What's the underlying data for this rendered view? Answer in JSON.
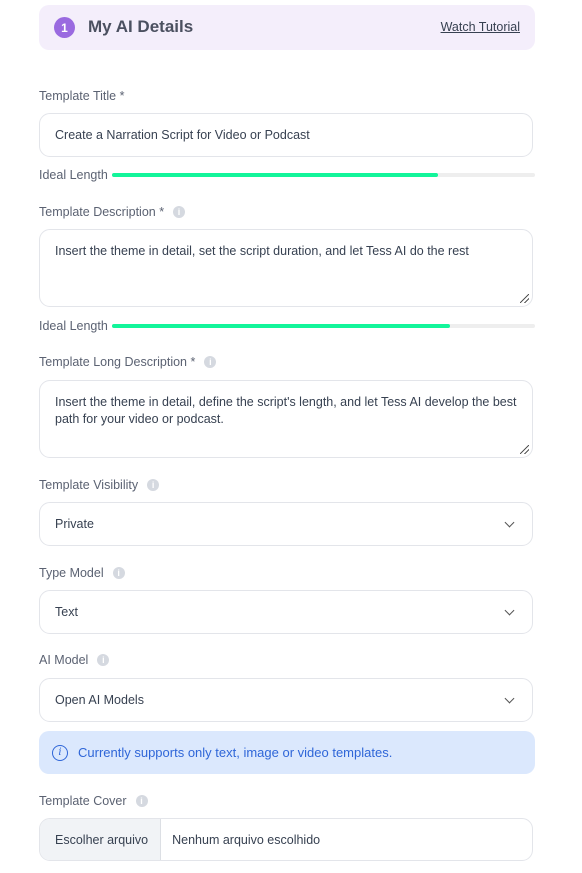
{
  "header": {
    "step_number": "1",
    "title": "My AI Details",
    "tutorial_link": "Watch Tutorial"
  },
  "colors": {
    "accent_purple": "#9a6ae0",
    "header_bg": "#f4eefb",
    "progress_fill": "#12f59a",
    "alert_bg": "#dbe8fd",
    "alert_text": "#2f66d8"
  },
  "fields": {
    "title": {
      "label": "Template Title *",
      "value": "Create a Narration Script for Video or Podcast",
      "ideal_length_label": "Ideal Length",
      "ideal_length_progress": 0.77
    },
    "description": {
      "label": "Template Description *",
      "value": "Insert the theme in detail, set the script duration, and let Tess AI do the rest",
      "ideal_length_label": "Ideal Length",
      "ideal_length_progress": 0.8
    },
    "long_description": {
      "label": "Template Long Description *",
      "value": "Insert the theme in detail, define the script's length, and let Tess AI develop the best path for your video or podcast."
    },
    "visibility": {
      "label": "Template Visibility",
      "selected": "Private"
    },
    "type_model": {
      "label": "Type Model",
      "selected": "Text"
    },
    "ai_model": {
      "label": "AI Model",
      "selected": "Open AI Models"
    },
    "cover": {
      "label": "Template Cover",
      "button_label": "Escolher arquivo",
      "status": "Nenhum arquivo escolhido"
    }
  },
  "alert": {
    "icon": "info-circle-icon",
    "text": "Currently supports only text, image or video templates."
  },
  "icons": {
    "info": "i"
  }
}
